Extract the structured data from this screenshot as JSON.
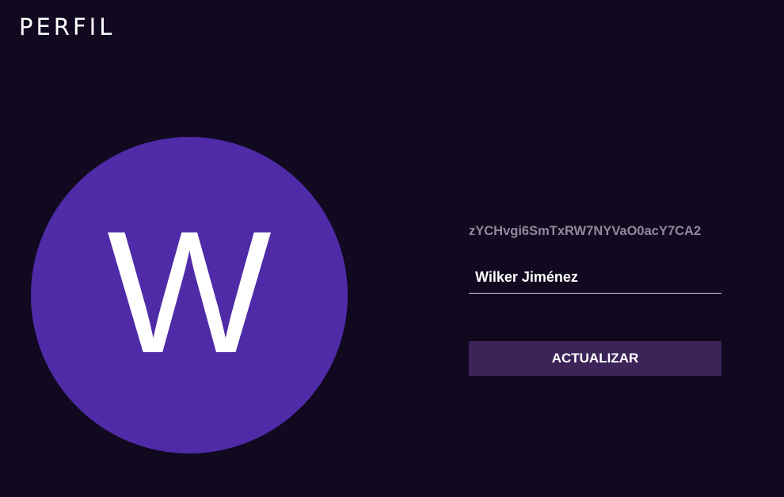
{
  "header": {
    "title": "PERFIL"
  },
  "profile": {
    "avatar_initial": "W",
    "avatar_color": "#4f2ba8",
    "user_id": "zYCHvgi6SmTxRW7NYVaO0acY7CA2",
    "name_value": "Wilker Jiménez",
    "update_label": "ACTUALIZAR"
  },
  "colors": {
    "background": "#110920",
    "button": "#3c2458",
    "muted_text": "#8f8a9a"
  }
}
